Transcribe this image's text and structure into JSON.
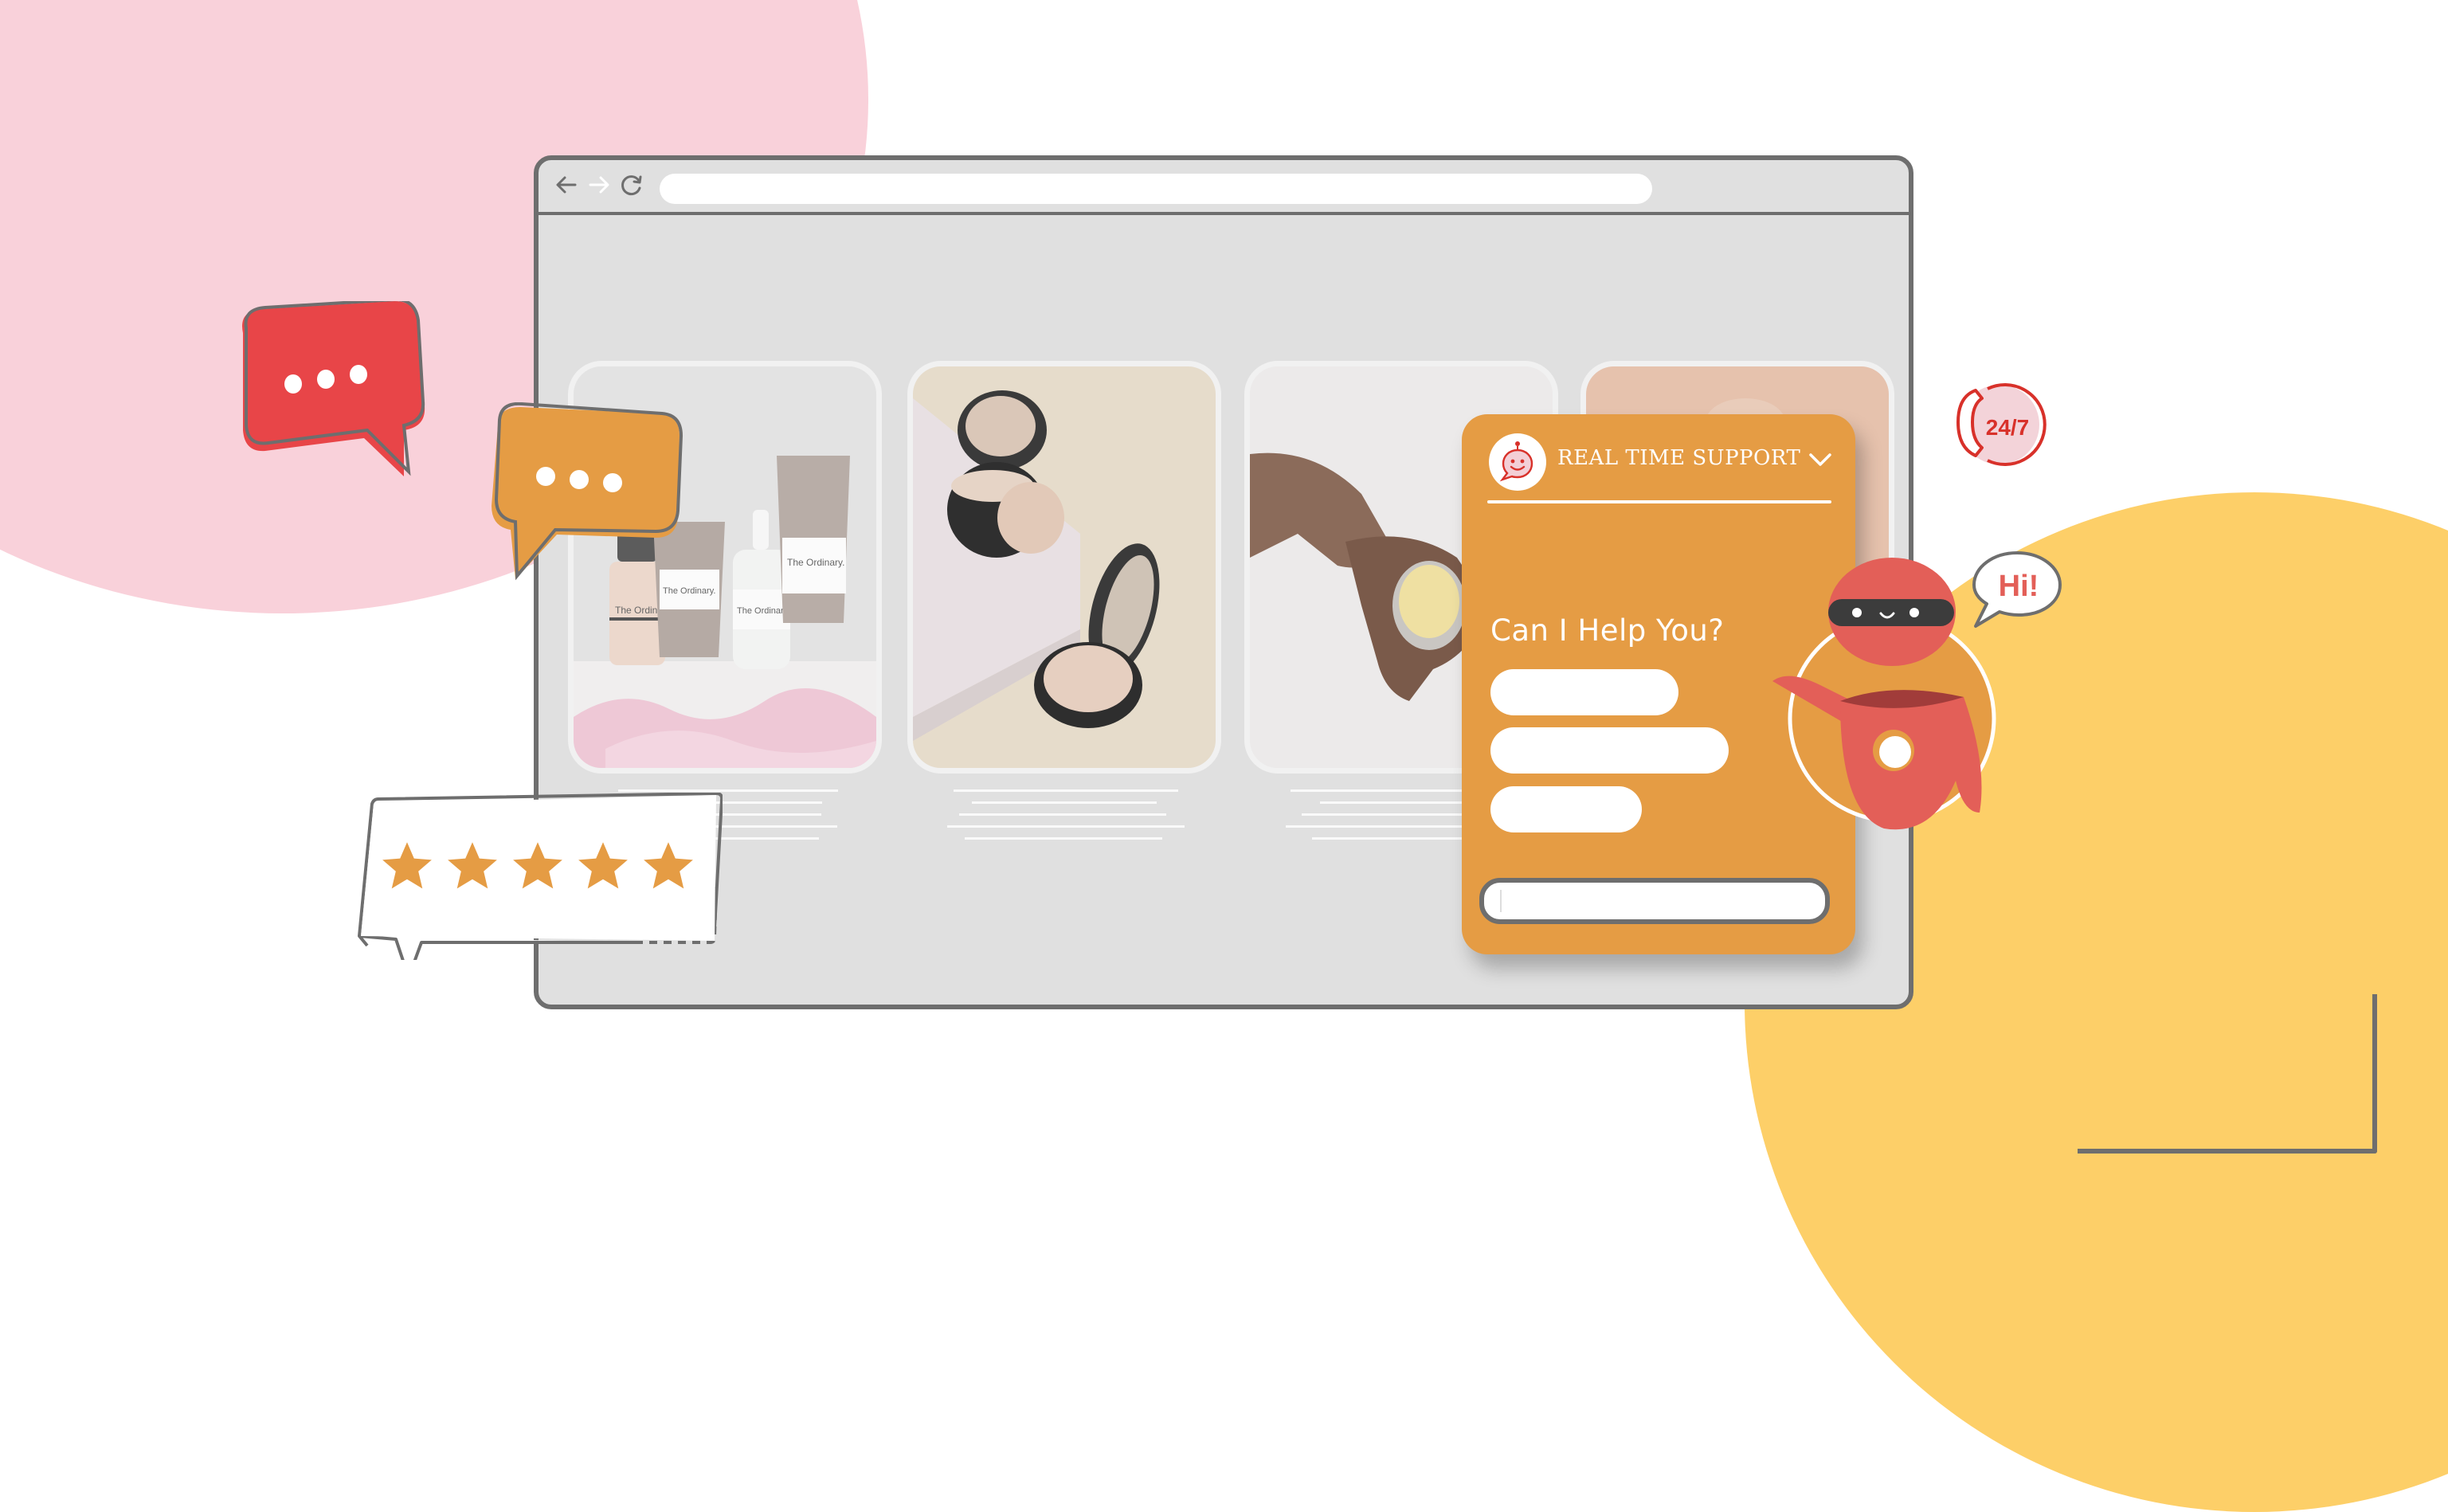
{
  "browser": {
    "back_icon": "arrow-left-icon",
    "forward_icon": "arrow-right-icon",
    "reload_icon": "reload-icon",
    "address_value": "",
    "address_placeholder": ""
  },
  "products": [
    {
      "image": "skincare-bottles-with-petals",
      "brand_label": "The Ordinary."
    },
    {
      "image": "powder-compacts-on-wood",
      "brand_label": ""
    },
    {
      "image": "hand-with-balm-tin",
      "brand_label": ""
    },
    {
      "image": "peach-toned-product",
      "brand_label": ""
    }
  ],
  "chat": {
    "avatar_icon": "chat-smiley-icon",
    "title": "REAL TIME SUPPORT",
    "collapse_icon": "chevron-down-icon",
    "question": "Can I Help You?",
    "options": [
      "",
      "",
      ""
    ],
    "input_value": "",
    "input_placeholder": ""
  },
  "decorations": {
    "typing_bubble_red_icon": "typing-bubble-icon",
    "typing_bubble_orange_icon": "typing-bubble-icon",
    "rating": {
      "stars": 5,
      "max": 5
    },
    "support_badge": "24/7",
    "support_icon": "phone-icon",
    "robot_greeting": "Hi!"
  },
  "colors": {
    "pink": "#f9d1da",
    "yellow": "#fdcf68",
    "orange": "#e59c44",
    "red": "#e84548",
    "robot_red": "#e35f58",
    "outline_gray": "#6e6e6e",
    "browser_gray": "#e0e0e0"
  }
}
